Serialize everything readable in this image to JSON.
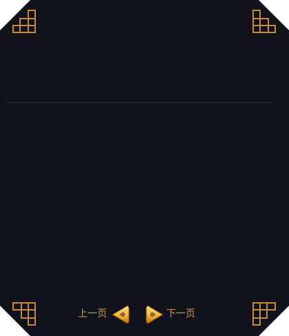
{
  "colors": {
    "panel_background": "#10141a",
    "accent": "#c98a3d",
    "label_text": "#d39a4c",
    "divider": "#2c3036",
    "arrow_gold": "#f5b92e"
  },
  "corners": {
    "top_left_icon": "lattice-corner-icon",
    "top_right_icon": "lattice-corner-icon",
    "bottom_left_icon": "lattice-corner-icon",
    "bottom_right_icon": "lattice-corner-icon"
  },
  "pagination": {
    "prev_label": "上一页",
    "next_label": "下一页",
    "prev_icon": "arrow-left-icon",
    "next_icon": "arrow-right-icon"
  }
}
